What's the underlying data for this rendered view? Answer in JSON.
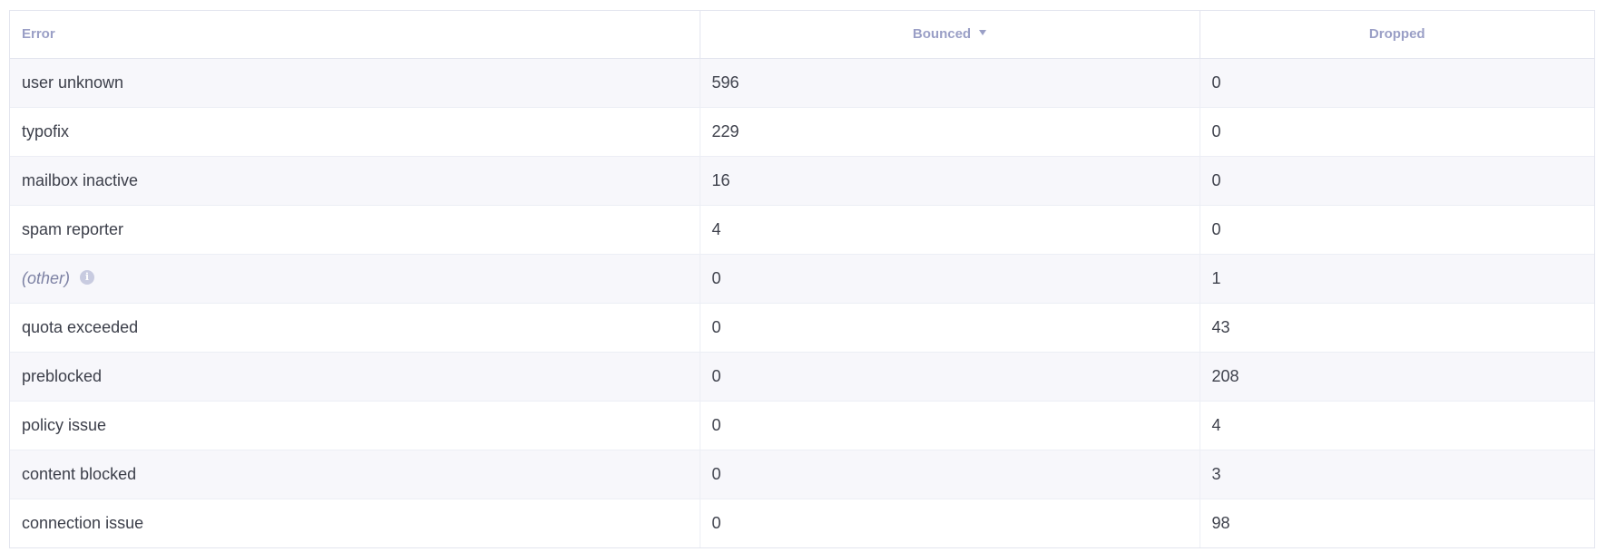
{
  "table": {
    "headers": {
      "error": "Error",
      "bounced": "Bounced",
      "dropped": "Dropped"
    },
    "sort": {
      "column": "bounced",
      "direction": "desc",
      "icon": "caret-down-icon"
    },
    "rows": [
      {
        "error": "user unknown",
        "bounced": "596",
        "dropped": "0"
      },
      {
        "error": "typofix",
        "bounced": "229",
        "dropped": "0"
      },
      {
        "error": "mailbox inactive",
        "bounced": "16",
        "dropped": "0"
      },
      {
        "error": "spam reporter",
        "bounced": "4",
        "dropped": "0"
      },
      {
        "error": "(other)",
        "bounced": "0",
        "dropped": "1",
        "info_icon": "i"
      },
      {
        "error": "quota exceeded",
        "bounced": "0",
        "dropped": "43"
      },
      {
        "error": "preblocked",
        "bounced": "0",
        "dropped": "208"
      },
      {
        "error": "policy issue",
        "bounced": "0",
        "dropped": "4"
      },
      {
        "error": "content blocked",
        "bounced": "0",
        "dropped": "3"
      },
      {
        "error": "connection issue",
        "bounced": "0",
        "dropped": "98"
      }
    ]
  },
  "colors": {
    "header_text": "#9a9fc6",
    "body_text": "#3c3f4a",
    "row_alt_bg": "#f7f7fb",
    "border": "#e3e5ef",
    "info_icon_bg": "#c8cbe0"
  }
}
